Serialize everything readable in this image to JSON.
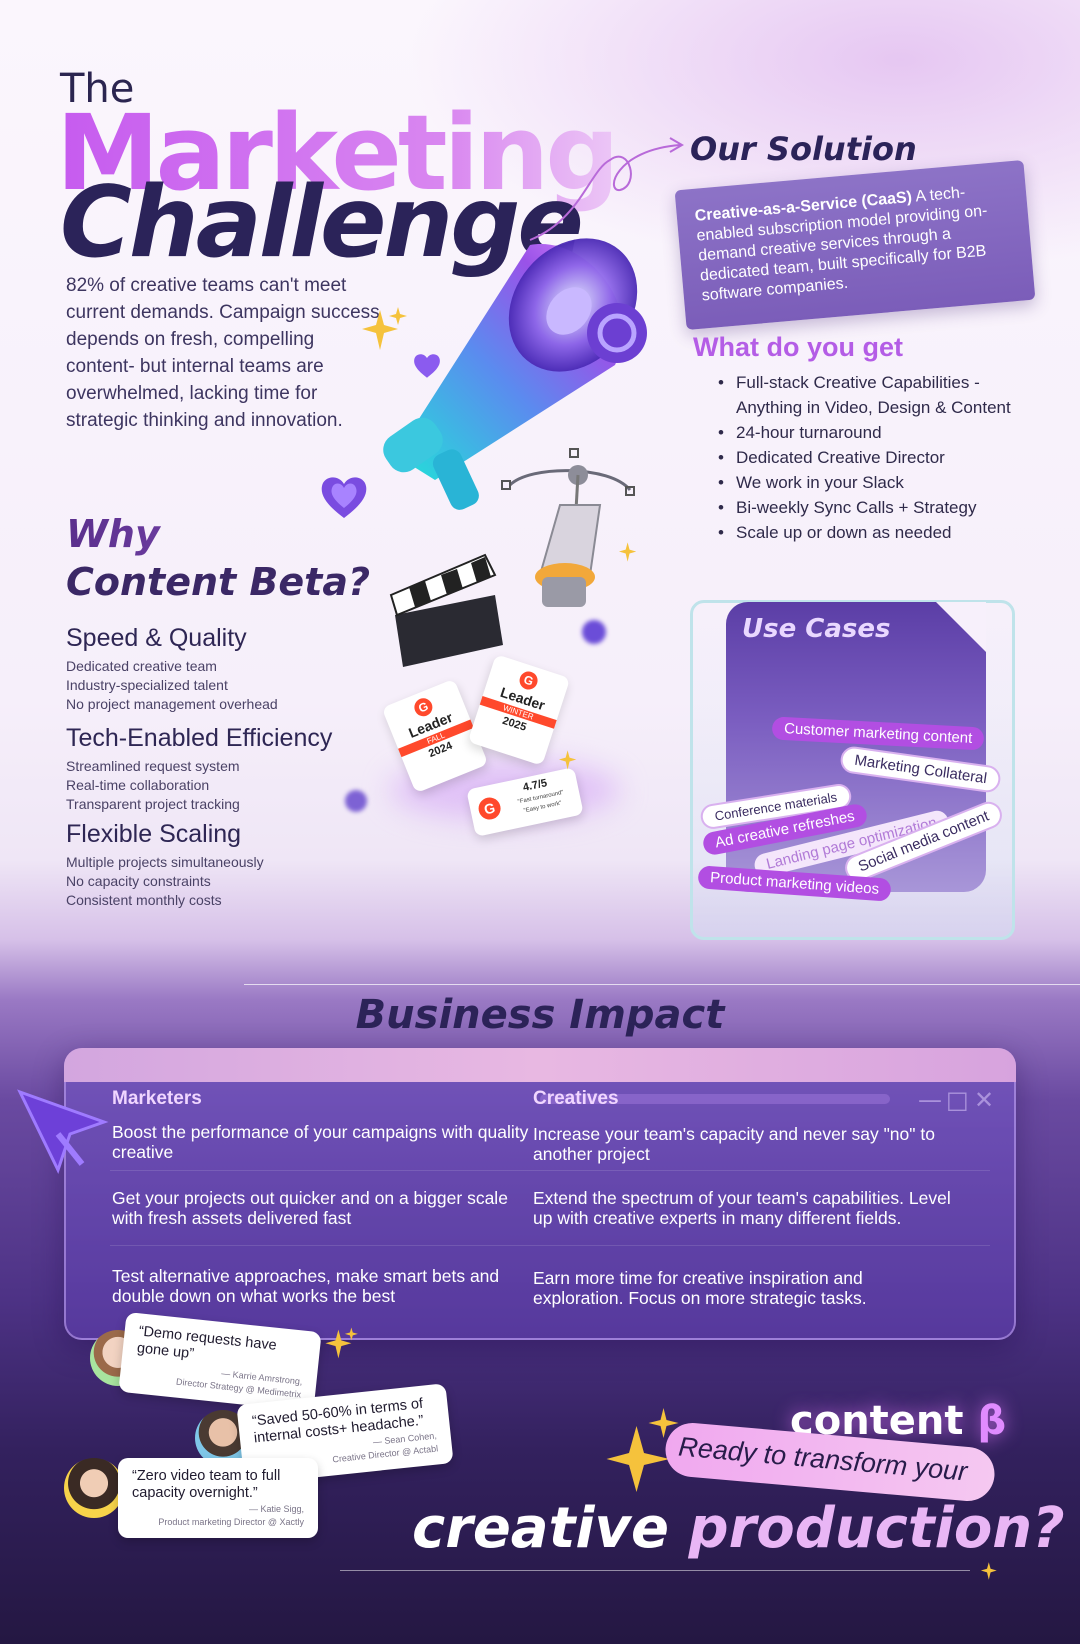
{
  "hero": {
    "the": "The",
    "marketing": "Marketing",
    "challenge": "Challenge",
    "intro": "82% of creative teams can't meet current demands. Campaign success depends on fresh, compelling content- but internal teams are overwhelmed, lacking time for strategic thinking and innovation."
  },
  "why": {
    "line1": "Why",
    "line2": "Content Beta?",
    "features": [
      {
        "title": "Speed & Quality",
        "lines": [
          "Dedicated creative team",
          "Industry-specialized talent",
          "No project management overhead"
        ]
      },
      {
        "title": "Tech-Enabled Efficiency",
        "lines": [
          "Streamlined request system",
          "Real-time collaboration",
          "Transparent project tracking"
        ]
      },
      {
        "title": "Flexible Scaling",
        "lines": [
          "Multiple projects simultaneously",
          "No capacity constraints",
          "Consistent monthly costs"
        ]
      }
    ]
  },
  "solution": {
    "title": "Our Solution",
    "bold": "Creative-as-a-Service (CaaS)",
    "text": " A tech-enabled subscription model providing on-demand creative services through a dedicated team, built specifically for B2B software companies."
  },
  "what_you_get": {
    "title": "What do you get",
    "items": [
      "Full-stack Creative Capabilities - Anything in Video, Design & Content",
      "24-hour turnaround",
      "Dedicated Creative Director",
      "We work in your Slack",
      "Bi-weekly Sync Calls + Strategy",
      "Scale up or down as needed"
    ]
  },
  "use_cases": {
    "title": "Use Cases",
    "tags": [
      "Customer marketing content",
      "Marketing Collateral",
      "Conference materials",
      "Ad creative refreshes",
      "Landing page optimization",
      "Social media content",
      "Product marketing videos"
    ]
  },
  "badges": {
    "leader": "Leader",
    "fall": "FALL",
    "year1": "2024",
    "winter": "WINTER",
    "year2": "2025",
    "rating": "4.7/5",
    "fast": "\"Fast turnaround\"",
    "easy": "\"Easy to work\""
  },
  "impact": {
    "title": "Business Impact",
    "marketers_title": "Marketers",
    "creatives_title": "Creatives",
    "rows": [
      {
        "m": "Boost the performance of your campaigns with quality creative",
        "c": "Increase your team's capacity and never say \"no\" to another project"
      },
      {
        "m": "Get your projects out quicker and on a bigger scale with fresh assets delivered fast",
        "c": "Extend the spectrum of your team's capabilities. Level up with creative experts in many different fields."
      },
      {
        "m": "Test alternative approaches, make smart bets and double down on what works the best",
        "c": "Earn more time for creative inspiration and exploration. Focus on more strategic tasks."
      }
    ]
  },
  "testimonials": [
    {
      "quote": "“Demo requests have gone up”",
      "author": "— Karrie Amrstrong,",
      "role": "Director Strategy @ Medimetrix"
    },
    {
      "quote": "“Saved 50-60% in terms of internal costs+ headache.”",
      "author": "— Sean Cohen,",
      "role": "Creative Director @ Actabl"
    },
    {
      "quote": "“Zero video team to full capacity overnight.”",
      "author": "— Katie Sigg,",
      "role": "Product marketing Director @ Xactly"
    }
  ],
  "cta": {
    "brand": "content",
    "brand_symbol": "β",
    "pill": "Ready to transform your",
    "big1": "creative ",
    "big2": "production?"
  },
  "colors": {
    "accent_purple": "#b24ee2",
    "navy": "#2b2359",
    "violet_panel": "#6a4aa1"
  }
}
